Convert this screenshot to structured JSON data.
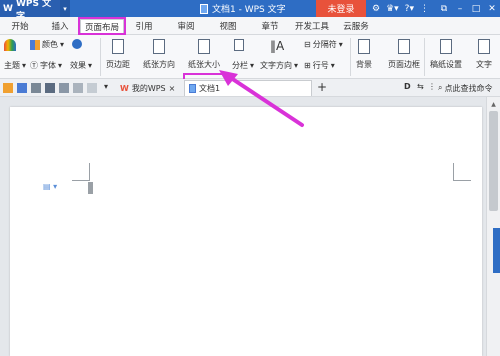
{
  "titlebar": {
    "app_name": "WPS 文字",
    "doc_title": "文档1 - WPS 文字",
    "login_label": "未登录"
  },
  "menu": {
    "tabs": [
      "开始",
      "插入",
      "页面布局",
      "引用",
      "审阅",
      "视图",
      "章节",
      "开发工具",
      "云服务"
    ],
    "active": "页面布局"
  },
  "ribbon": {
    "theme_label": "主题",
    "colors_label": "颜色",
    "fonts_label": "字体",
    "effects_label": "效果",
    "margins_label": "页边距",
    "orientation_label": "纸张方向",
    "size_label": "纸张大小",
    "columns_label": "分栏",
    "text_direction_label": "文字方向",
    "breaks_label": "分隔符",
    "line_numbers_label": "行号",
    "background_label": "背景",
    "page_border_label": "页面边框",
    "draft_label": "稿纸设置",
    "text_label": "文字"
  },
  "tabs_bar": {
    "my_wps_label": "我的WPS",
    "doc_tab_label": "文档1",
    "add_tab_label": "+",
    "search_placeholder": "点此查找命令"
  },
  "colors": {
    "titlebar_bg": "#2e6dc4",
    "login_bg": "#e8523b",
    "highlight": "#d932d8",
    "arrow": "#d932d8"
  }
}
